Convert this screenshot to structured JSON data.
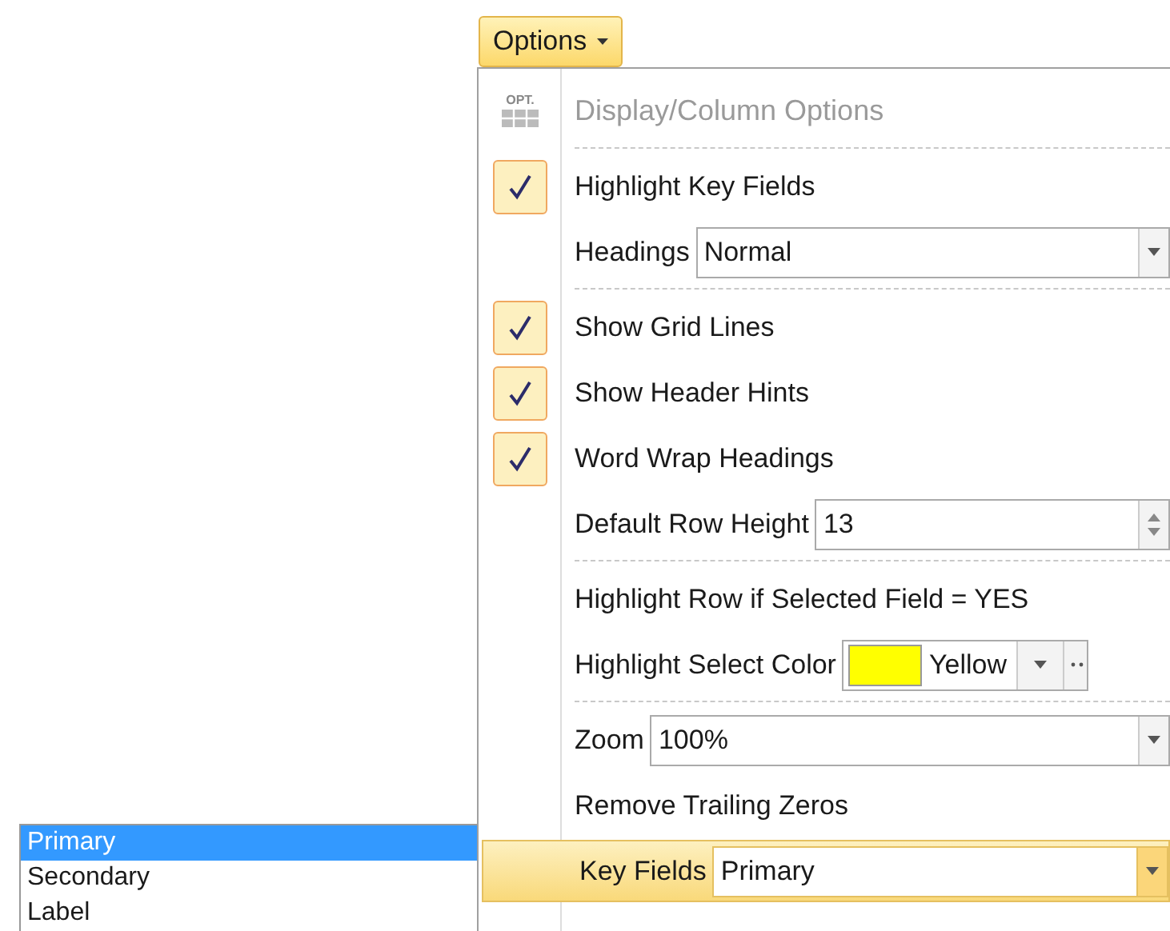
{
  "options_button": {
    "label": "Options"
  },
  "menu": {
    "items": [
      {
        "kind": "header",
        "icon_label": "OPT.",
        "label": "Display/Column Options"
      },
      {
        "kind": "separator"
      },
      {
        "kind": "check",
        "label": "Highlight Key Fields",
        "checked": true,
        "selected": false
      },
      {
        "kind": "combo",
        "label": "Headings",
        "value": "Normal",
        "selected": false
      },
      {
        "kind": "separator"
      },
      {
        "kind": "check",
        "label": "Show Grid Lines",
        "checked": true,
        "selected": false
      },
      {
        "kind": "check",
        "label": "Show Header Hints",
        "checked": true,
        "selected": false
      },
      {
        "kind": "check",
        "label": "Word Wrap Headings",
        "checked": true,
        "selected": false
      },
      {
        "kind": "spin",
        "label": "Default Row Height",
        "value": "13",
        "selected": false
      },
      {
        "kind": "separator"
      },
      {
        "kind": "text",
        "label": "Highlight Row if Selected Field = YES",
        "selected": false
      },
      {
        "kind": "color",
        "label": "Highlight Select Color",
        "value": "Yellow",
        "color": "#ffff00",
        "selected": false
      },
      {
        "kind": "separator"
      },
      {
        "kind": "combo",
        "label": "Zoom",
        "value": "100%",
        "selected": false
      },
      {
        "kind": "text",
        "label": "Remove Trailing Zeros",
        "selected": false
      },
      {
        "kind": "combo",
        "label": "Key Fields",
        "value": "Primary",
        "selected": true
      }
    ]
  },
  "dropdown_list": {
    "items": [
      {
        "label": "Primary",
        "selected": true
      },
      {
        "label": "Secondary",
        "selected": false
      },
      {
        "label": "Label",
        "selected": false
      }
    ]
  }
}
